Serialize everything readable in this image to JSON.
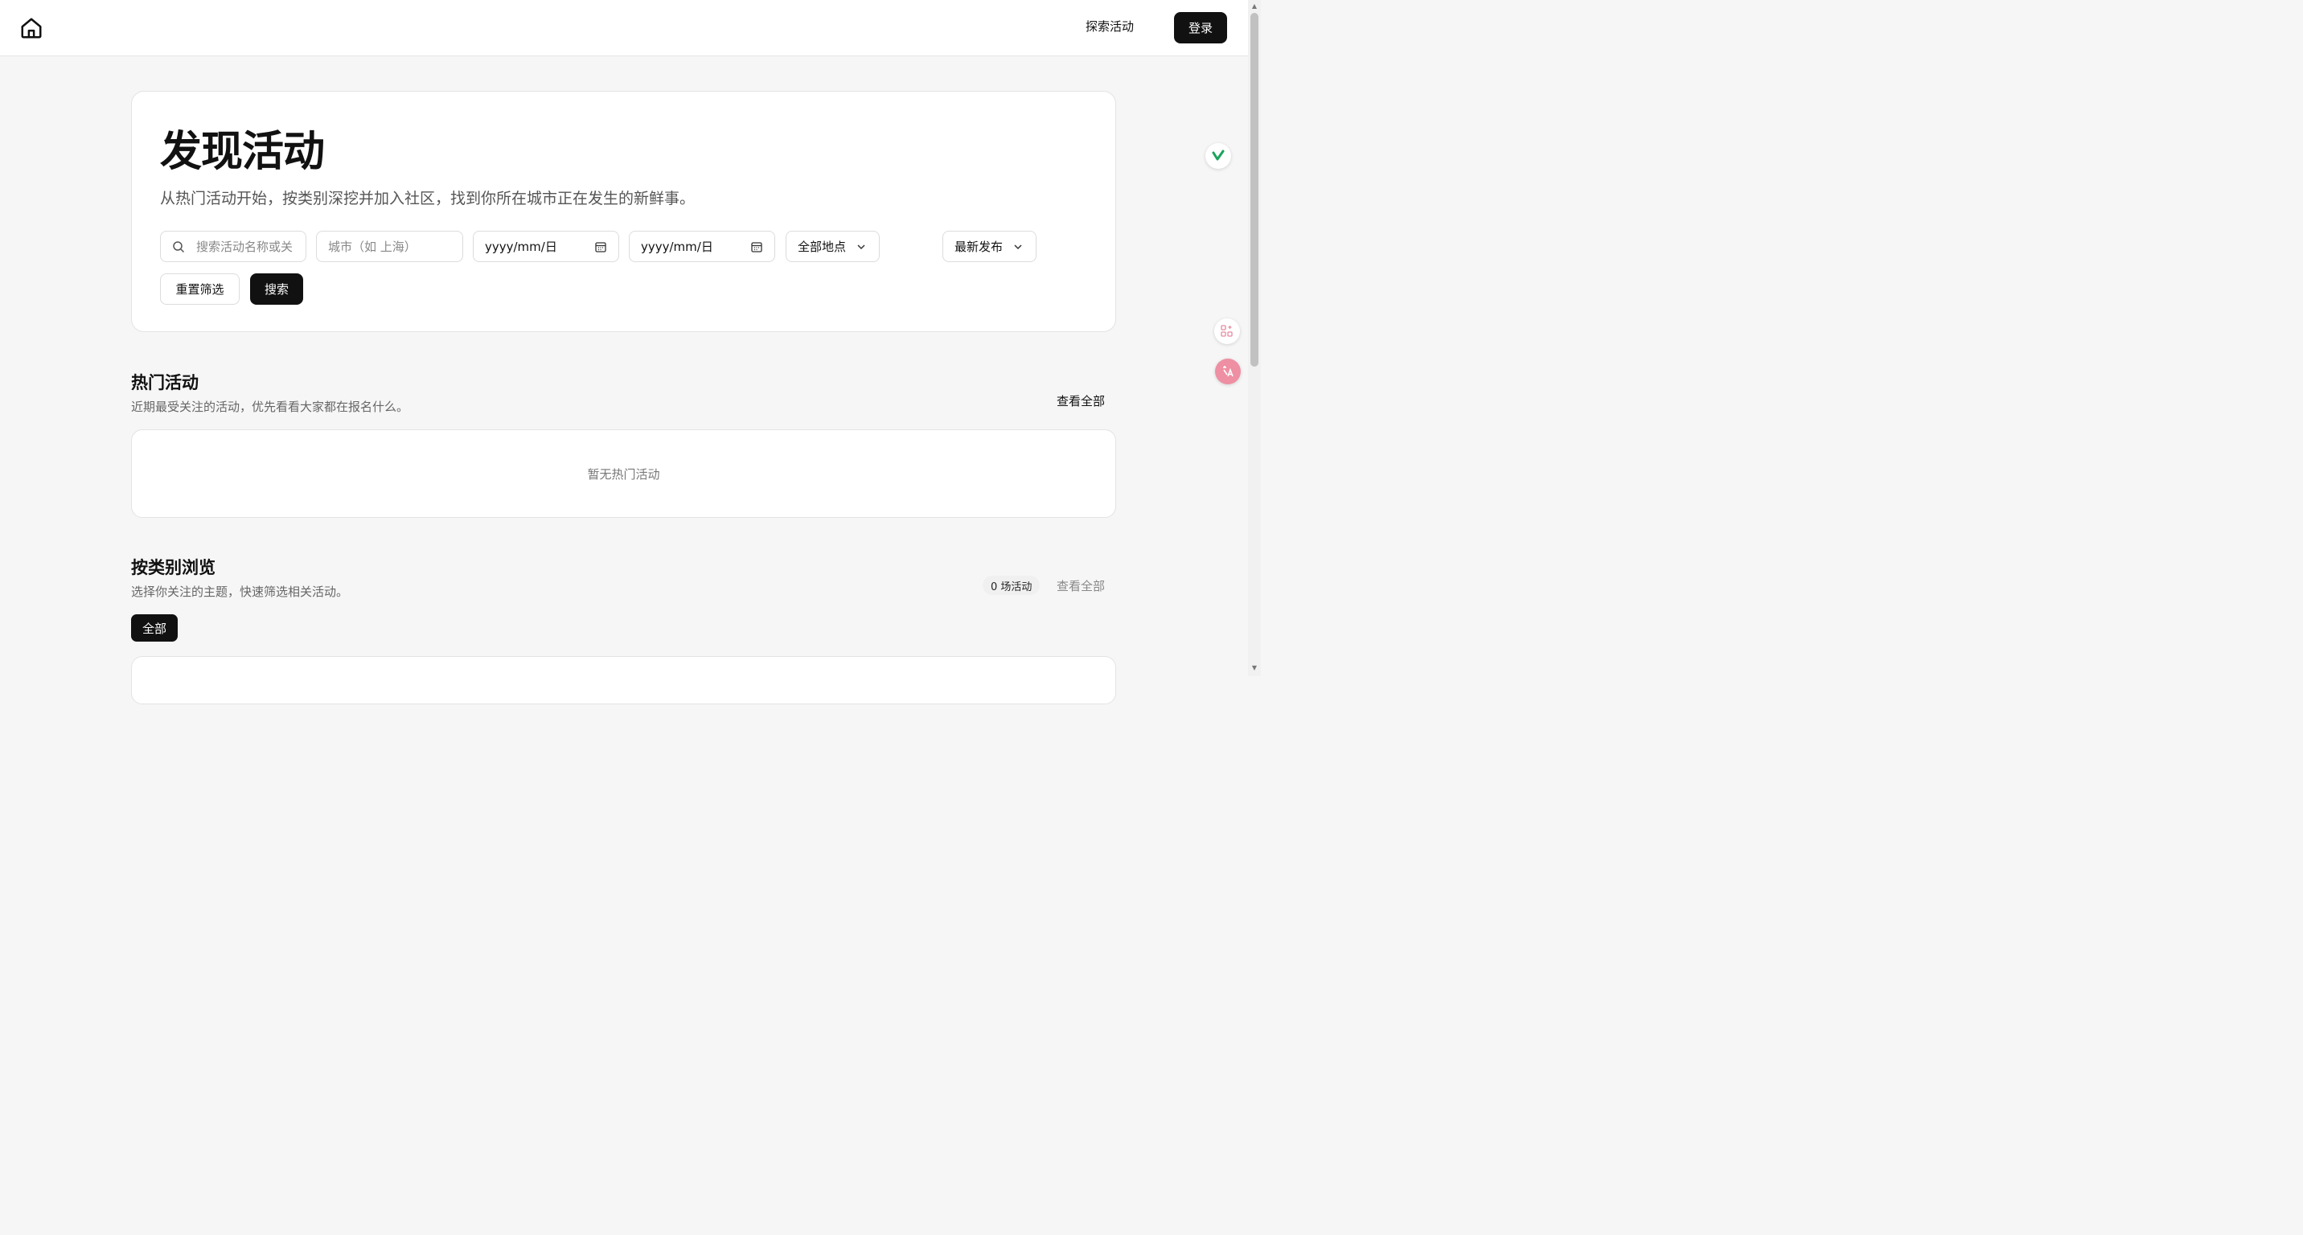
{
  "header": {
    "nav_explore": "探索活动",
    "login_label": "登录"
  },
  "hero": {
    "title": "发现活动",
    "subtitle": "从热门活动开始，按类别深挖并加入社区，找到你所在城市正在发生的新鲜事。"
  },
  "filters": {
    "search_placeholder": "搜索活动名称或关",
    "city_placeholder": "城市（如 上海）",
    "date_start": "yyyy/mm/日",
    "date_end": "yyyy/mm/日",
    "location_select": "全部地点",
    "sort_select": "最新发布",
    "reset_label": "重置筛选",
    "search_label": "搜索"
  },
  "hot": {
    "title": "热门活动",
    "subtitle": "近期最受关注的活动，优先看看大家都在报名什么。",
    "view_all": "查看全部",
    "empty_text": "暂无热门活动"
  },
  "categories": {
    "title": "按类别浏览",
    "subtitle": "选择你关注的主题，快速筛选相关活动。",
    "count": "0 场活动",
    "view_all": "查看全部",
    "chips": [
      {
        "label": "全部"
      }
    ]
  },
  "colors": {
    "primary": "#111111",
    "background": "#f6f6f6",
    "muted_text": "#666666"
  }
}
